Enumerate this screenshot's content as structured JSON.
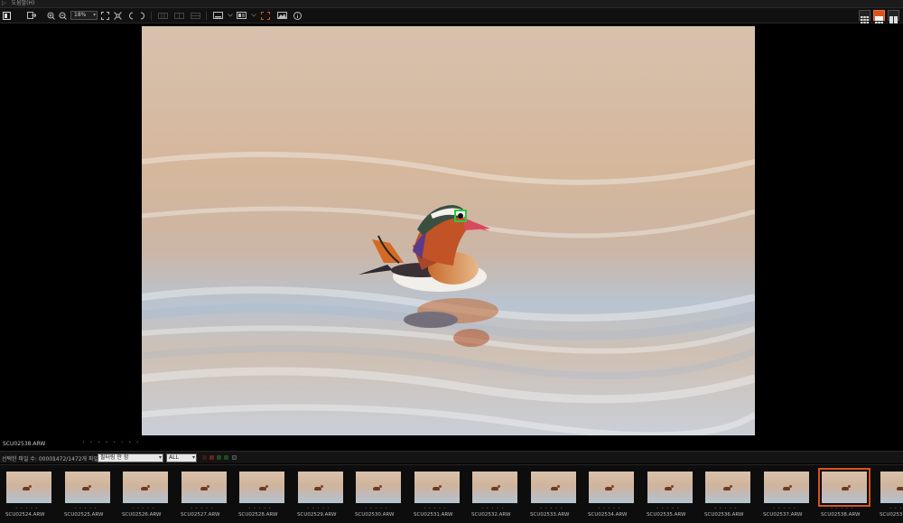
{
  "menubar": {
    "items": [
      "▷",
      "도움말(H)"
    ]
  },
  "toolbar": {
    "zoom_value": "18%",
    "icons": [
      "app-icon",
      "export-icon",
      "zoom-in-icon",
      "zoom-out-icon",
      "fit-icon",
      "actual-size-icon",
      "rotate-left-icon",
      "rotate-right-icon",
      "compare-1-icon",
      "compare-2-icon",
      "compare-3-icon",
      "single-view-icon",
      "info-overlay-icon",
      "focus-point-icon",
      "histogram-icon",
      "info-icon"
    ],
    "view_modes": [
      "grid-view-icon",
      "single-filmstrip-view-icon",
      "compare-view-icon"
    ]
  },
  "viewer": {
    "current_file": "SCU02538.ARW",
    "rating_marks": "• • • • •"
  },
  "filterbar": {
    "selected_count_label": "선택한 파일 수: 00001",
    "total_label": "1472/1472개 파일",
    "filter_value": "필터링 안 함",
    "scope_value": "ALL"
  },
  "filmstrip": {
    "thumbnails": [
      {
        "name": "SCU02524.ARW",
        "selected": false
      },
      {
        "name": "SCU02525.ARW",
        "selected": false
      },
      {
        "name": "SCU02526.ARW",
        "selected": false
      },
      {
        "name": "SCU02527.ARW",
        "selected": false
      },
      {
        "name": "SCU02528.ARW",
        "selected": false
      },
      {
        "name": "SCU02529.ARW",
        "selected": false
      },
      {
        "name": "SCU02530.ARW",
        "selected": false
      },
      {
        "name": "SCU02531.ARW",
        "selected": false
      },
      {
        "name": "SCU02532.ARW",
        "selected": false
      },
      {
        "name": "SCU02533.ARW",
        "selected": false
      },
      {
        "name": "SCU02534.ARW",
        "selected": false
      },
      {
        "name": "SCU02535.ARW",
        "selected": false
      },
      {
        "name": "SCU02536.ARW",
        "selected": false
      },
      {
        "name": "SCU02537.ARW",
        "selected": false
      },
      {
        "name": "SCU02538.ARW",
        "selected": true
      },
      {
        "name": "SCU0253",
        "selected": false
      }
    ]
  },
  "colors": {
    "accent": "#d9541e",
    "background": "#000000",
    "toolbar": "#111111",
    "focus_box": "#27c93f"
  }
}
